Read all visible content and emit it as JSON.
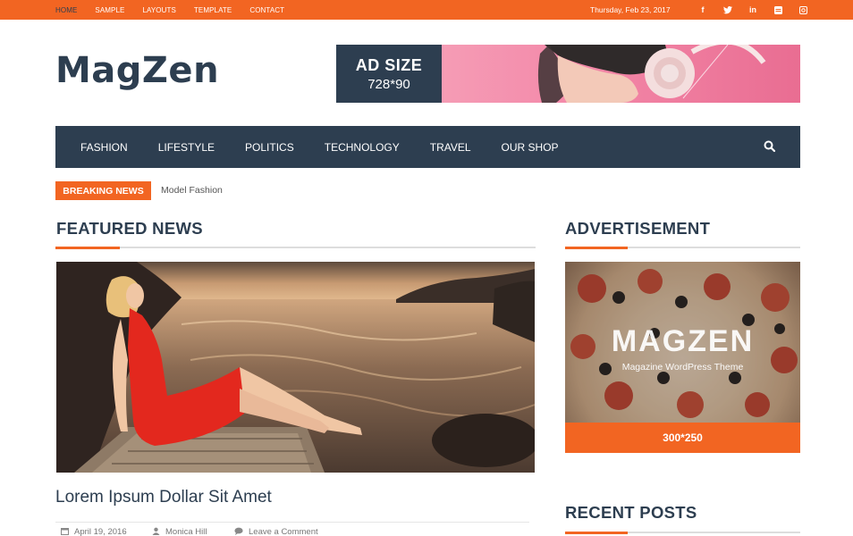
{
  "topbar": {
    "nav": [
      "HOME",
      "SAMPLE",
      "LAYOUTS",
      "TEMPLATE",
      "CONTACT"
    ],
    "date": "Thursday, Feb 23, 2017",
    "social_icons": [
      "facebook-icon",
      "twitter-icon",
      "linkedin-icon",
      "youtube-icon",
      "instagram-icon"
    ]
  },
  "header": {
    "logo": "MagZen",
    "ad_line1": "AD SIZE",
    "ad_line2": "728*90"
  },
  "mainnav": {
    "items": [
      "FASHION",
      "LIFESTYLE",
      "POLITICS",
      "TECHNOLOGY",
      "TRAVEL",
      "OUR SHOP"
    ]
  },
  "breaking": {
    "label": "BREAKING NEWS",
    "text": "Model Fashion"
  },
  "featured": {
    "heading": "FEATURED NEWS",
    "article_title": "Lorem Ipsum Dollar Sit Amet",
    "date": "April 19, 2016",
    "author": "Monica Hill",
    "comments": "Leave a Comment"
  },
  "sidebar": {
    "ad_heading": "ADVERTISEMENT",
    "ad_brand": "MAGZEN",
    "ad_tagline": "Magazine WordPress Theme",
    "ad_size": "300*250",
    "recent_heading": "RECENT POSTS"
  },
  "colors": {
    "accent": "#f26522",
    "navy": "#2d3e50"
  }
}
